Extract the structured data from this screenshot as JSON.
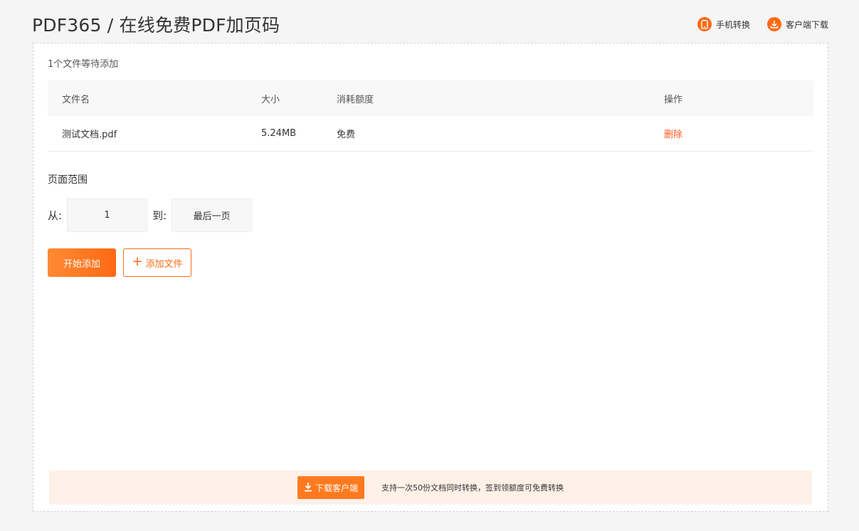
{
  "header": {
    "title": "PDF365 / 在线免费PDF加页码",
    "links": [
      {
        "label": "手机转换",
        "icon": "mobile-icon"
      },
      {
        "label": "客户端下载",
        "icon": "download-client-icon"
      }
    ]
  },
  "upload": {
    "count_label": "1个文件等待添加"
  },
  "table": {
    "headers": {
      "name": "文件名",
      "size": "大小",
      "cost": "消耗额度",
      "action": "操作"
    },
    "rows": [
      {
        "name": "测试文档.pdf",
        "size": "5.24MB",
        "cost": "免费",
        "action": "删除"
      }
    ]
  },
  "range": {
    "title": "页面范围",
    "from_label": "从:",
    "from_value": "1",
    "to_label": "到:",
    "to_value": "最后一页"
  },
  "actions": {
    "start_label": "开始添加",
    "add_label": "添加文件"
  },
  "promo": {
    "button_label": "下载客户端",
    "text": "支持一次50份文档同时转换，签到领额度可免费转换"
  },
  "colors": {
    "accent": "#ff6a13",
    "delete": "#ff5a1f",
    "promo_bg": "#fff1e7"
  }
}
